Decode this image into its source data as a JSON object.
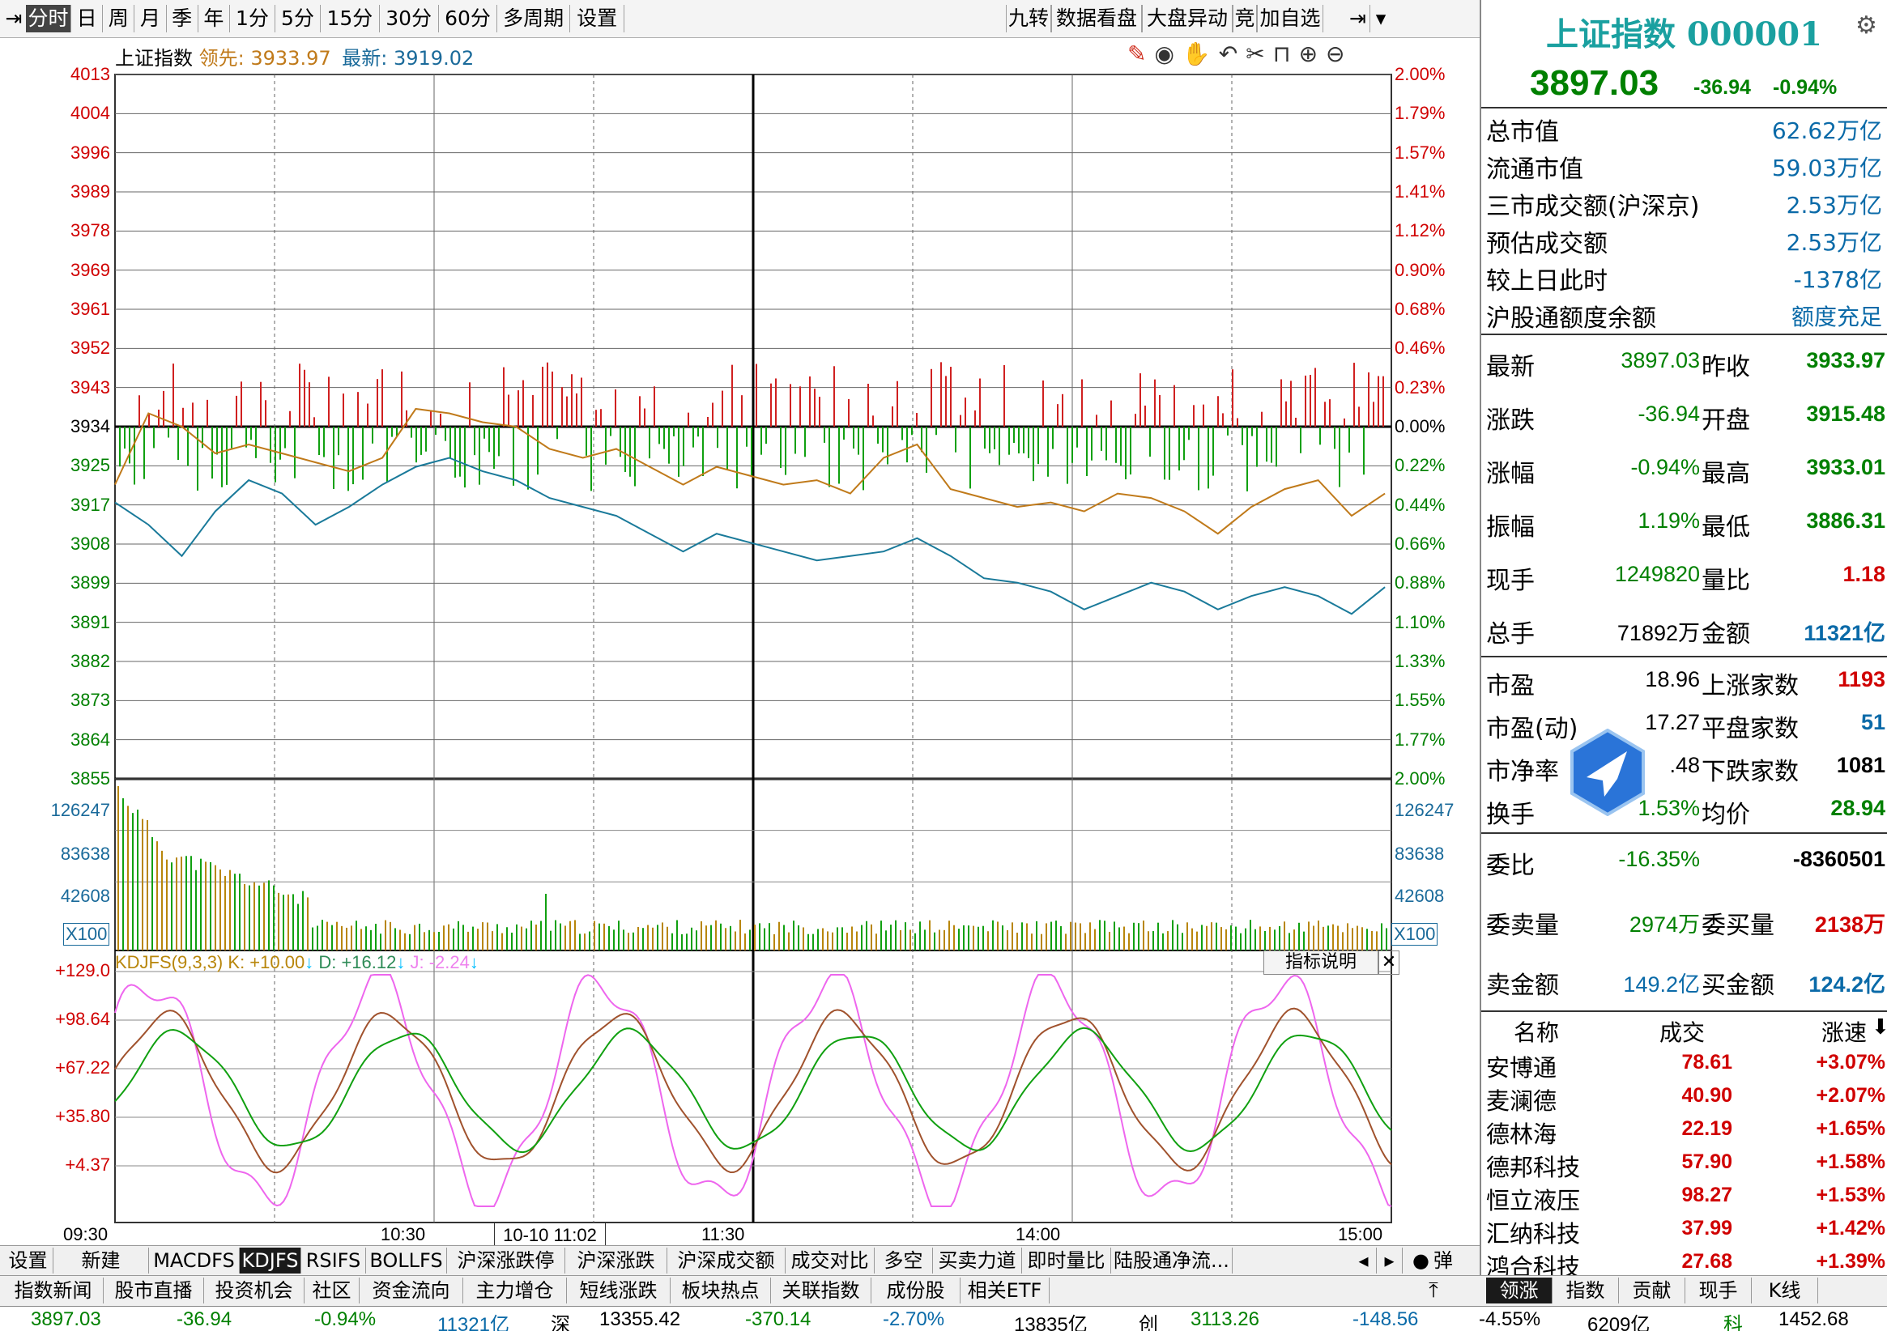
{
  "toolbar": {
    "period_tabs": [
      "分时",
      "日",
      "周",
      "月",
      "季",
      "年",
      "1分",
      "5分",
      "15分",
      "30分",
      "60分",
      "多周期",
      "设置"
    ],
    "right_tabs": [
      "九转",
      "数据看盘",
      "大盘异动",
      "竞",
      "加自选"
    ]
  },
  "chart_header": {
    "name": "上证指数",
    "lead_label": "领先:",
    "lead_value": "3933.97",
    "latest_label": "最新:",
    "latest_value": "3919.02"
  },
  "price_axis": {
    "left": [
      "4013",
      "4004",
      "3996",
      "3989",
      "3978",
      "3969",
      "3961",
      "3952",
      "3943",
      "3934",
      "3925",
      "3917",
      "3908",
      "3899",
      "3891",
      "3882",
      "3873",
      "3864",
      "3855"
    ],
    "right": [
      "2.00%",
      "1.79%",
      "1.57%",
      "1.41%",
      "1.12%",
      "0.90%",
      "0.68%",
      "0.46%",
      "0.23%",
      "0.00%",
      "0.22%",
      "0.44%",
      "0.66%",
      "0.88%",
      "1.10%",
      "1.33%",
      "1.55%",
      "1.77%",
      "2.00%"
    ]
  },
  "volume_axis": {
    "labels": [
      "126247",
      "83638",
      "42608"
    ],
    "unit": "X100"
  },
  "kdj": {
    "title": "KDJFS(9,3,3)",
    "k": "K: +10.00",
    "d": "D: +16.12",
    "j": "J: -2.24",
    "axis": [
      "+129.0",
      "+98.64",
      "+67.22",
      "+35.80",
      "+4.37"
    ],
    "button": "指标说明"
  },
  "time_axis": {
    "labels": [
      "09:30",
      "10:30",
      "11:30",
      "14:00",
      "15:00"
    ],
    "cursor_time": "10-10 11:02"
  },
  "chart_data": {
    "type": "line",
    "x_labels": [
      "09:30",
      "10:30",
      "11:30",
      "14:00",
      "15:00"
    ],
    "price_series": {
      "name": "最新",
      "values": [
        3917,
        3912,
        3905,
        3915,
        3922,
        3919,
        3912,
        3916,
        3921,
        3925,
        3927,
        3924,
        3922,
        3918,
        3916,
        3914,
        3910,
        3906,
        3910,
        3908,
        3906,
        3904,
        3905,
        3906,
        3909,
        3905,
        3900,
        3899,
        3897,
        3893,
        3896,
        3899,
        3897,
        3893,
        3896,
        3898,
        3896,
        3892,
        3898
      ]
    },
    "avg_series": {
      "name": "领先",
      "values": [
        3921,
        3937,
        3934,
        3928,
        3930,
        3928,
        3926,
        3924,
        3927,
        3938,
        3937,
        3935,
        3934,
        3929,
        3927,
        3929,
        3925,
        3921,
        3925,
        3923,
        3921,
        3922,
        3919,
        3927,
        3930,
        3920,
        3918,
        3916,
        3917,
        3915,
        3919,
        3918,
        3915,
        3910,
        3916,
        3920,
        3922,
        3914,
        3919
      ]
    },
    "yrange": [
      3855,
      4013
    ],
    "base": 3934
  },
  "right_panel": {
    "title": "上证指数 000001",
    "price": "3897.03",
    "change": "-36.94",
    "change_pct": "-0.94%",
    "stats": [
      {
        "label": "总市值",
        "value": "62.62万亿"
      },
      {
        "label": "流通市值",
        "value": "59.03万亿"
      },
      {
        "label": "三市成交额(沪深京)",
        "value": "2.53万亿"
      },
      {
        "label": "预估成交额",
        "value": "2.53万亿"
      },
      {
        "label": "较上日此时",
        "value": "-1378亿"
      },
      {
        "label": "沪股通额度余额",
        "value": "额度充足"
      }
    ],
    "quotes": [
      {
        "l1": "最新",
        "v1": "3897.03",
        "l2": "昨收",
        "v2": "3933.97"
      },
      {
        "l1": "涨跌",
        "v1": "-36.94",
        "l2": "开盘",
        "v2": "3915.48"
      },
      {
        "l1": "涨幅",
        "v1": "-0.94%",
        "l2": "最高",
        "v2": "3933.01"
      },
      {
        "l1": "振幅",
        "v1": "1.19%",
        "l2": "最低",
        "v2": "3886.31"
      },
      {
        "l1": "现手",
        "v1": "1249820",
        "l2": "量比",
        "v2": "1.18"
      },
      {
        "l1": "总手",
        "v1": "71892万",
        "l2": "金额",
        "v2": "11321亿"
      }
    ],
    "valuation": [
      {
        "l1": "市盈",
        "v1": "18.96",
        "l2": "上涨家数",
        "v2": "1193"
      },
      {
        "l1": "市盈(动)",
        "v1": "17.27",
        "l2": "平盘家数",
        "v2": "51"
      },
      {
        "l1": "市净率",
        "v1": ".48",
        "l2": "下跌家数",
        "v2": "1081"
      },
      {
        "l1": "换手",
        "v1": "1.53%",
        "l2": "均价",
        "v2": "28.94"
      }
    ],
    "orders": [
      {
        "l1": "委比",
        "v1": "-16.35%",
        "l2": "",
        "v2": "-8360501"
      },
      {
        "l1": "委卖量",
        "v1": "2974万",
        "l2": "委买量",
        "v2": "2138万"
      },
      {
        "l1": "卖金额",
        "v1": "149.2亿",
        "l2": "买金额",
        "v2": "124.2亿"
      }
    ],
    "list_headers": [
      "名称",
      "成交",
      "涨速"
    ],
    "list": [
      {
        "name": "安博通",
        "price": "78.61",
        "speed": "+3.07%"
      },
      {
        "name": "麦澜德",
        "price": "40.90",
        "speed": "+2.07%"
      },
      {
        "name": "德林海",
        "price": "22.19",
        "speed": "+1.65%"
      },
      {
        "name": "德邦科技",
        "price": "57.90",
        "speed": "+1.58%"
      },
      {
        "name": "恒立液压",
        "price": "98.27",
        "speed": "+1.53%"
      },
      {
        "name": "汇纳科技",
        "price": "37.99",
        "speed": "+1.42%"
      },
      {
        "name": "鸿合科技",
        "price": "27.68",
        "speed": "+1.39%"
      }
    ],
    "bottom_tabs": [
      "领涨",
      "指数",
      "贡献",
      "现手",
      "K线"
    ]
  },
  "indicator_tabs": [
    "设置",
    "新建",
    "MACDFS",
    "KDJFS",
    "RSIFS",
    "BOLLFS",
    "沪深涨跌停",
    "沪深涨跌",
    "沪深成交额",
    "成交对比",
    "多空",
    "买卖力道",
    "即时量比",
    "陆股通净流..."
  ],
  "popup_label": "弹",
  "news_tabs": [
    "指数新闻",
    "股市直播",
    "投资机会",
    "社区",
    "资金流向",
    "主力增仓",
    "短线涨跌",
    "板块热点",
    "关联指数",
    "成份股",
    "相关ETF"
  ],
  "status_bar": [
    "3897.03",
    "-36.94",
    "-0.94%",
    "11321亿",
    "深",
    "13355.42",
    "-370.14",
    "-2.70%",
    "13835亿",
    "创",
    "3113.26",
    "-148.56",
    "-4.55%",
    "6209亿",
    "科",
    "1452.68"
  ]
}
